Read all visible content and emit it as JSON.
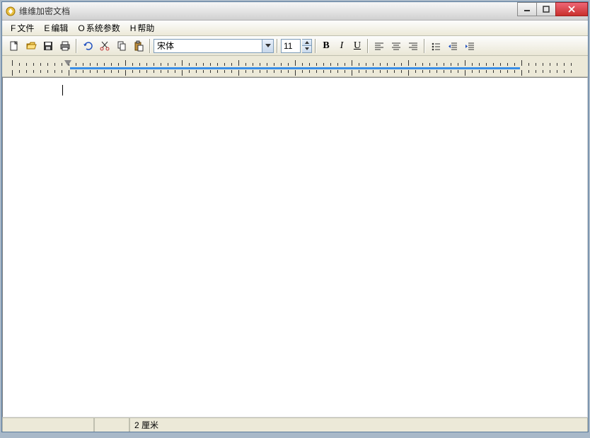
{
  "titlebar": {
    "title": "维维加密文档"
  },
  "menu": {
    "file_mn": "F",
    "file": "文件",
    "edit_mn": "E",
    "edit": "编辑",
    "opts_mn": "O",
    "opts": "系统参数",
    "help_mn": "H",
    "help": "帮助"
  },
  "toolbar": {
    "font_name": "宋体",
    "font_size": "11",
    "bold": "B",
    "italic": "I",
    "underline": "U"
  },
  "status": {
    "value": "2",
    "unit": "厘米"
  }
}
